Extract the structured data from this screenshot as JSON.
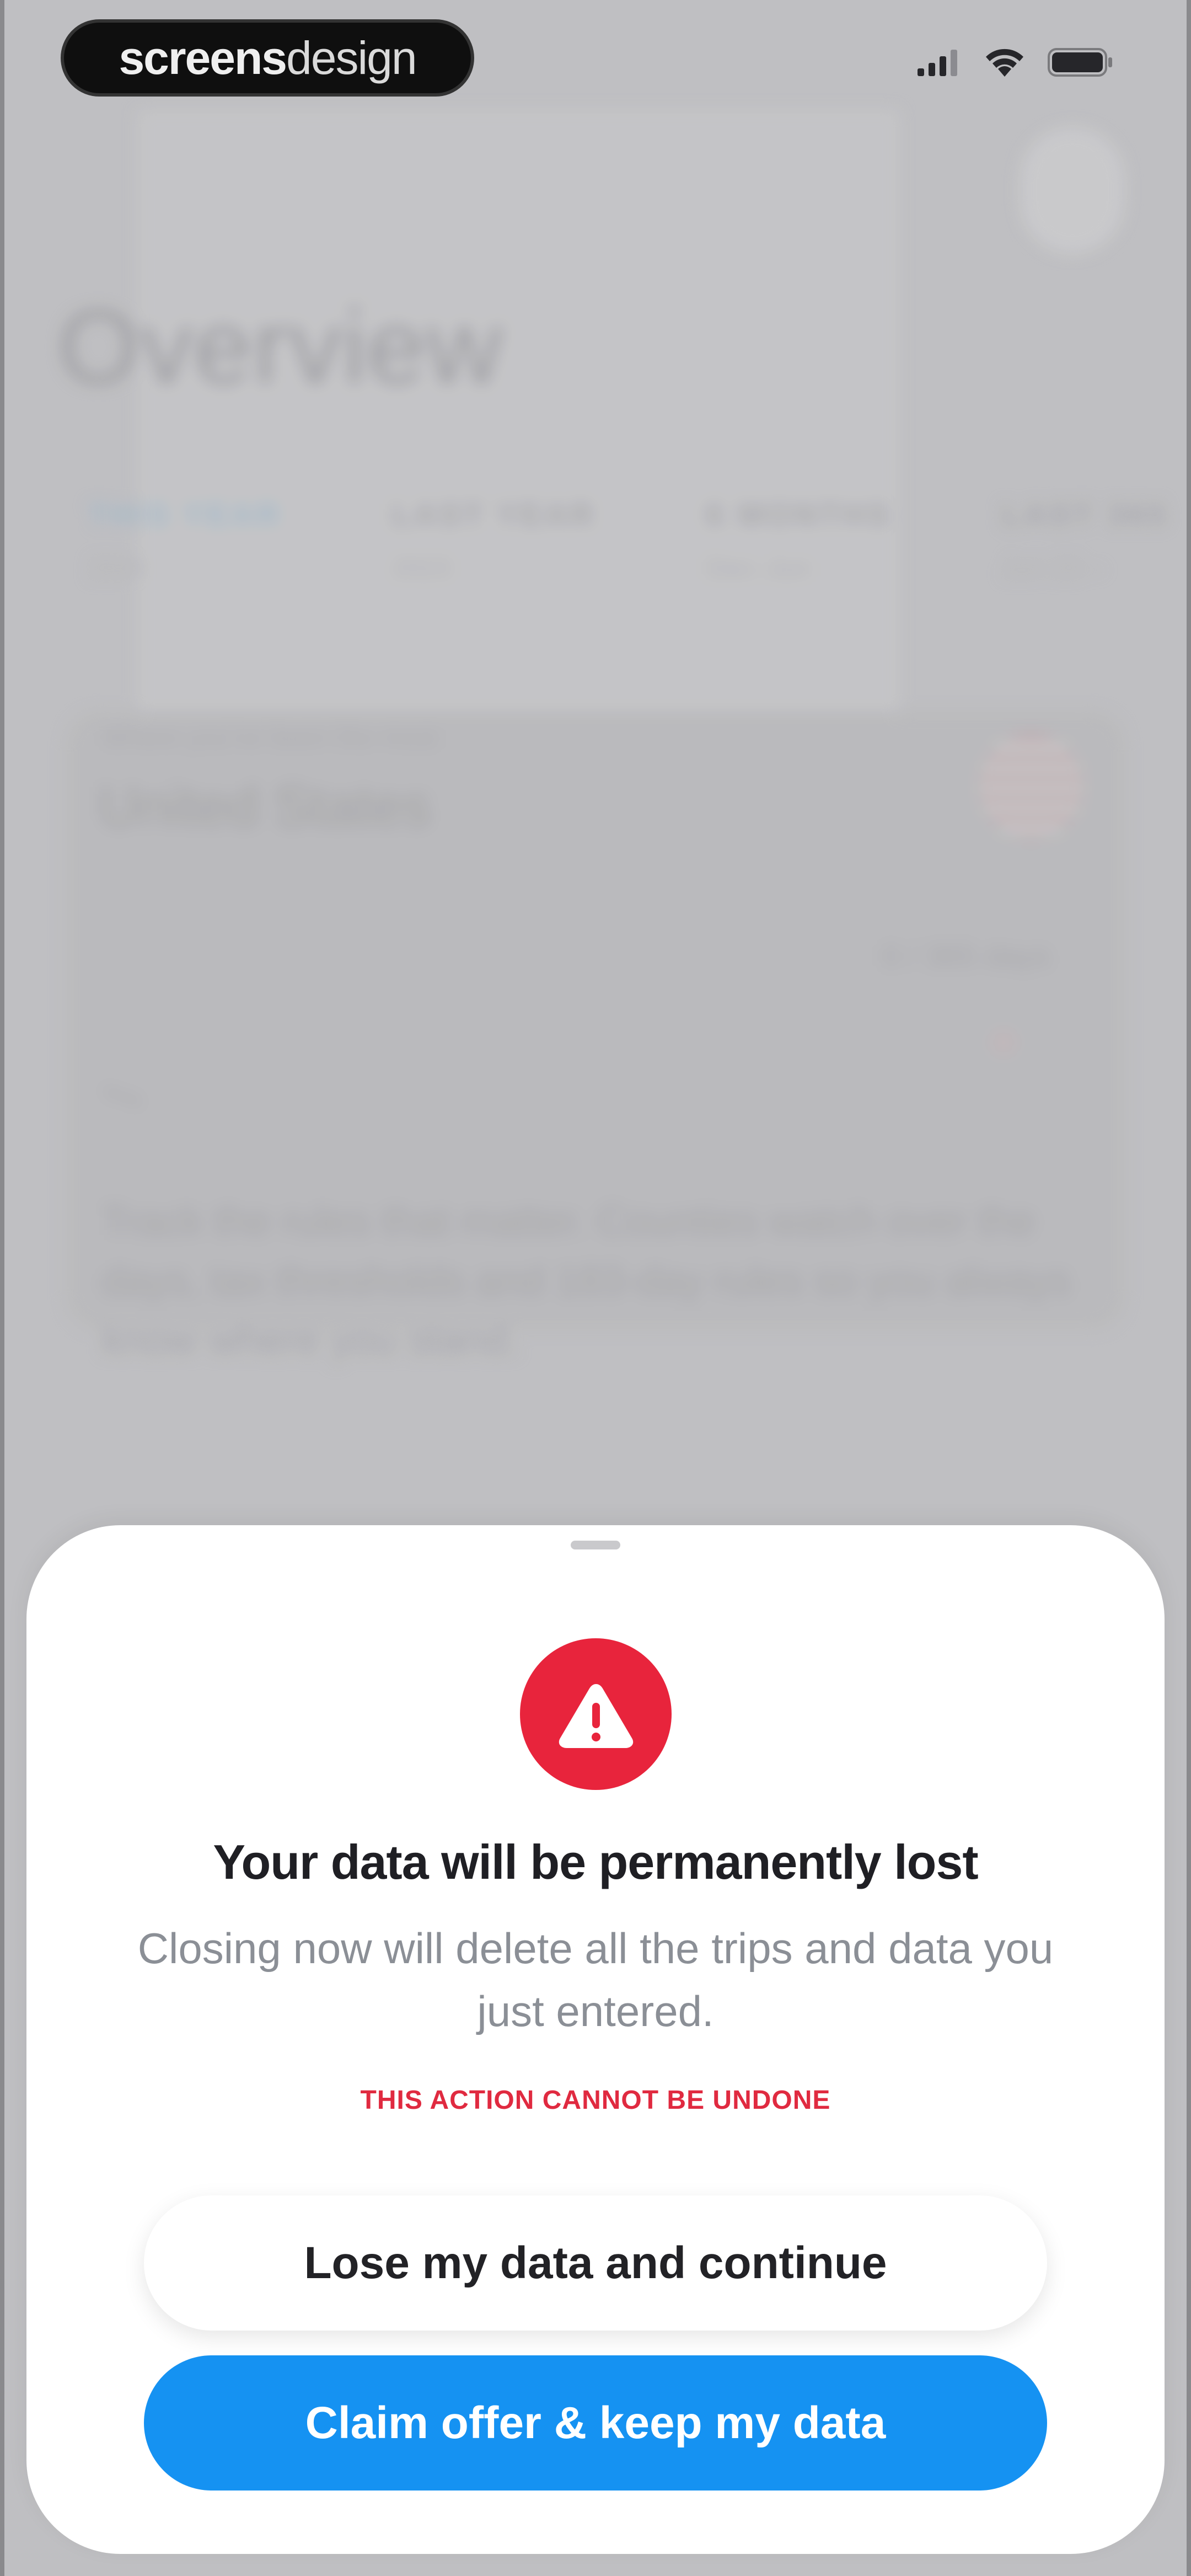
{
  "status_bar": {
    "brand_bold": "screens",
    "brand_light": "design",
    "signal_icon": "cellular-signal-icon",
    "wifi_icon": "wifi-icon",
    "battery_icon": "battery-icon"
  },
  "background_screen": {
    "title": "Overview",
    "range_tabs": [
      {
        "label": "THIS YEAR",
        "sub": "2024",
        "active": true
      },
      {
        "label": "LAST YEAR",
        "sub": "2023",
        "active": false
      },
      {
        "label": "6 MONTHS",
        "sub": "Dec–Jun",
        "active": false
      },
      {
        "label": "LAST 365",
        "sub": "Jun 23 –",
        "active": false
      }
    ],
    "card": {
      "caption": "Where you've been the most",
      "country": "United States",
      "stat": "0 / 365 days"
    },
    "body_text": "Track the rules that matter. Counties watch over the days, tax thresholds and 183-day rules so you always know where you stand."
  },
  "sheet": {
    "alert_icon": "warning-triangle-icon",
    "title": "Your data will be permanently lost",
    "message": "Closing now will delete all the trips and data you just entered.",
    "warning": "THIS ACTION CANNOT BE UNDONE",
    "secondary_button": "Lose my data and continue",
    "primary_button": "Claim offer & keep my data"
  },
  "colors": {
    "danger": "#e8243c",
    "primary": "#1592f2",
    "sheet_bg": "#ffffff"
  }
}
